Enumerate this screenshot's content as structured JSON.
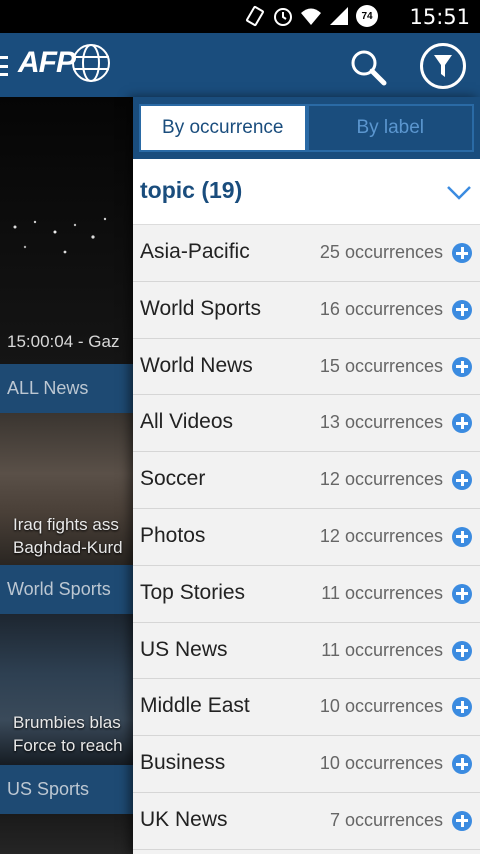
{
  "status_bar": {
    "time": "15:51",
    "battery_level": "74",
    "icons": [
      "rotation-lock-icon",
      "alarm-icon",
      "wifi-icon",
      "signal-icon",
      "battery-icon"
    ]
  },
  "app_bar": {
    "logo_text": "AFP",
    "colors": {
      "bar": "#1a4d7d",
      "accent": "#3b8be0"
    }
  },
  "feed": {
    "video_caption": "15:00:04 - Gaz",
    "sections": [
      "ALL News",
      "World Sports",
      "US Sports"
    ],
    "stories": [
      {
        "line1": "Iraq fights ass",
        "line2": "Baghdad-Kurd"
      },
      {
        "line1": "Brumbies blas",
        "line2": "Force to reach"
      }
    ]
  },
  "drawer": {
    "tabs": [
      {
        "label": "By occurrence",
        "active": true
      },
      {
        "label": "By label",
        "active": false
      }
    ],
    "group_title": "topic (19)",
    "items": [
      {
        "label": "Asia-Pacific",
        "count": "25 occurrences"
      },
      {
        "label": "World Sports",
        "count": "16 occurrences"
      },
      {
        "label": "World News",
        "count": "15 occurrences"
      },
      {
        "label": "All Videos",
        "count": "13 occurrences"
      },
      {
        "label": "Soccer",
        "count": "12 occurrences"
      },
      {
        "label": "Photos",
        "count": "12 occurrences"
      },
      {
        "label": "Top Stories",
        "count": "11 occurrences"
      },
      {
        "label": "US News",
        "count": "11 occurrences"
      },
      {
        "label": "Middle East",
        "count": "10 occurrences"
      },
      {
        "label": "Business",
        "count": "10 occurrences"
      },
      {
        "label": "UK News",
        "count": "7 occurrences"
      }
    ]
  }
}
